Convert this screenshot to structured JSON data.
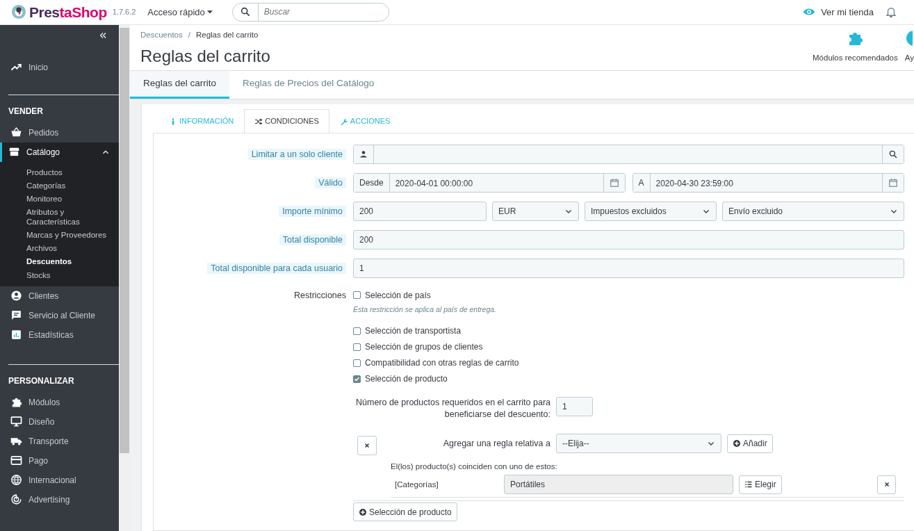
{
  "header": {
    "brand": "PrestaShop",
    "version": "1.7.6.2",
    "quick_access": "Acceso rápido",
    "search": {
      "placeholder": "Buscar"
    },
    "view_store": "Ver mi tienda"
  },
  "sidebar": {
    "sections": [
      {
        "items": [
          {
            "label": "Inicio",
            "selected": false
          }
        ]
      },
      {
        "title": "VENDER",
        "items": [
          {
            "label": "Pedidos",
            "selected": false
          },
          {
            "label": "Catálogo",
            "selected": true,
            "expanded": true,
            "children": [
              {
                "label": "Productos",
                "selected": false
              },
              {
                "label": "Categorías",
                "selected": false
              },
              {
                "label": "Monitoreo",
                "selected": false
              },
              {
                "label": "Atributos y Características",
                "selected": false
              },
              {
                "label": "Marcas y Proveedores",
                "selected": false
              },
              {
                "label": "Archivos",
                "selected": false
              },
              {
                "label": "Descuentos",
                "selected": true
              },
              {
                "label": "Stocks",
                "selected": false
              }
            ]
          },
          {
            "label": "Clientes",
            "selected": false
          },
          {
            "label": "Servicio al Cliente",
            "selected": false
          },
          {
            "label": "Estadísticas",
            "selected": false
          }
        ]
      },
      {
        "title": "PERSONALIZAR",
        "items": [
          {
            "label": "Módulos",
            "selected": false
          },
          {
            "label": "Diseño",
            "selected": false
          },
          {
            "label": "Transporte",
            "selected": false
          },
          {
            "label": "Pago",
            "selected": false
          },
          {
            "label": "Internacional",
            "selected": false
          },
          {
            "label": "Advertising",
            "selected": false
          }
        ]
      }
    ]
  },
  "breadcrumb": {
    "items": [
      "Descuentos",
      "Reglas del carrito"
    ],
    "separator": "/"
  },
  "title": "Reglas del carrito",
  "toolbar": [
    {
      "label": "Módulos recomendados"
    },
    {
      "label": "Ay"
    }
  ],
  "page_tabs": [
    {
      "label": "Reglas del carrito",
      "selected": true
    },
    {
      "label": "Reglas de Precios del Catálogo",
      "selected": false
    }
  ],
  "form_tabs": [
    {
      "label": "INFORMACIÓN",
      "selected": false
    },
    {
      "label": "CONDICIONES",
      "selected": true
    },
    {
      "label": "ACCIONES",
      "selected": false
    }
  ],
  "form_rows": [
    {
      "kind": "search",
      "label": "Limitar a un solo cliente"
    },
    {
      "kind": "daterange",
      "label": "Válido",
      "from_label": "Desde",
      "from": "2020-04-01 00:00:00",
      "to_label": "A",
      "to": "2020-04-30 23:59:00"
    },
    {
      "kind": "amount",
      "label": "Importe mínimo",
      "value": "200",
      "selects": [
        "EUR",
        "Impuestos excluidos",
        "Envío excluido"
      ]
    },
    {
      "kind": "text",
      "label": "Total disponible",
      "value": "200"
    },
    {
      "kind": "text",
      "label": "Total disponible para cada usuario",
      "value": "1"
    }
  ],
  "restrictions": {
    "label": "Restricciones",
    "options": [
      {
        "label": "Selección de país",
        "checked": false,
        "help": "Esta restricción se aplica al país de entrega."
      },
      {
        "label": "Selección de transportista",
        "checked": false
      },
      {
        "label": "Selección de grupos de clientes",
        "checked": false
      },
      {
        "label": "Compatibilidad con otras reglas de carrito",
        "checked": false
      },
      {
        "label": "Selección de producto",
        "checked": true
      }
    ]
  },
  "product_selection": {
    "quantity_label": "Número de productos requeridos en el carrito para beneficiarse del descuento:",
    "quantity": "1",
    "rule_label": "Agregar una regla relativa a",
    "rule_select": "--Elija--",
    "add_button": "Añadir",
    "match_label": "El(los) producto(s) coinciden con uno de estos:",
    "rules": [
      {
        "type": "[Categorías]",
        "value": "Portátiles",
        "choose_button": "Elegir"
      }
    ],
    "new_button": "Selección de producto"
  }
}
